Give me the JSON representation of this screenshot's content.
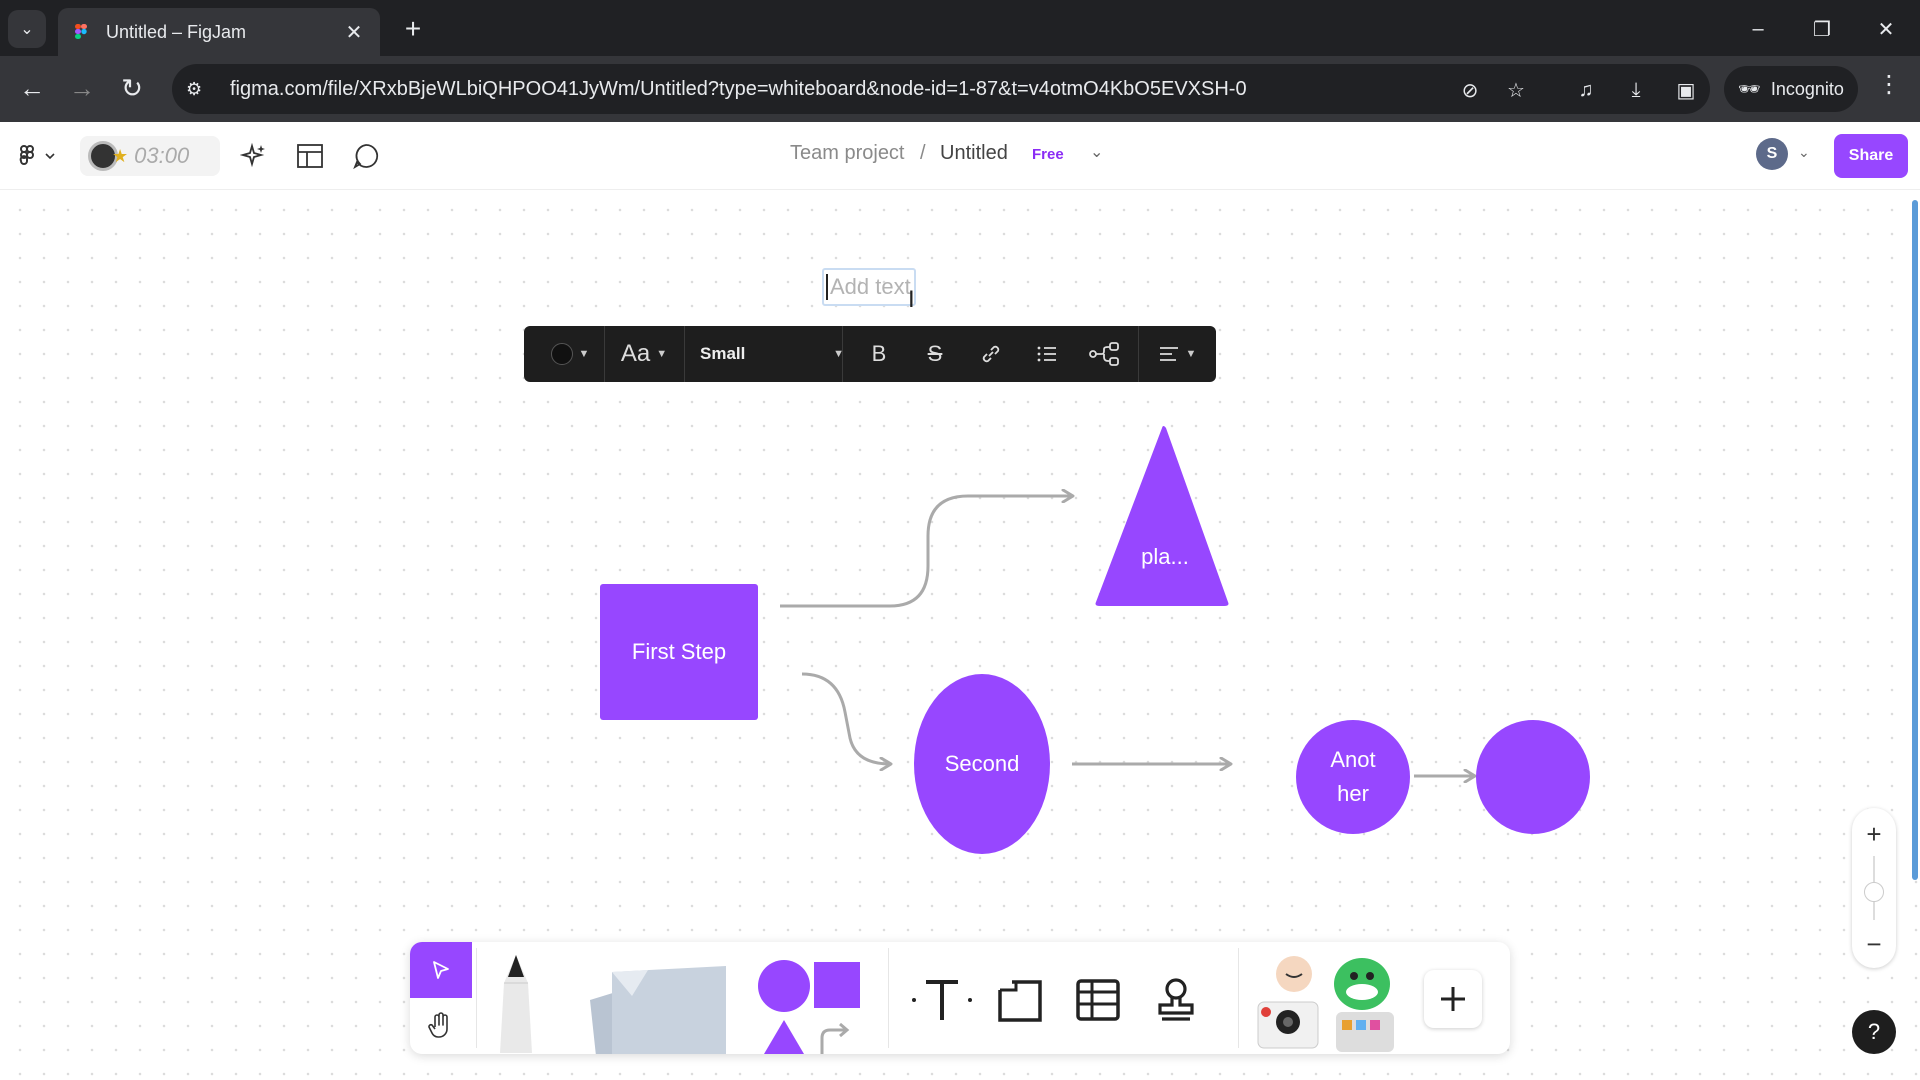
{
  "browser": {
    "tab_title": "Untitled – FigJam",
    "url": "figma.com/file/XRxbBjeWLbiQHPOO41JyWm/Untitled?type=whiteboard&node-id=1-87&t=v4otmO4KbO5EVXSH-0",
    "incognito_label": "Incognito"
  },
  "header": {
    "timer": "03:00",
    "project": "Team project",
    "separator": "/",
    "file_title": "Untitled",
    "plan_badge": "Free",
    "user_initial": "S",
    "share_label": "Share"
  },
  "canvas": {
    "text_placeholder": "Add text",
    "text_toolbar": {
      "font_icon": "Aa",
      "size_value": "Small"
    },
    "shapes": {
      "first_step": "First Step",
      "triangle": "pla...",
      "second": "Second",
      "another": "Anot\nher",
      "last": ""
    }
  },
  "zoom": {
    "in": "+",
    "out": "−"
  },
  "help": "?",
  "colors": {
    "accent": "#9747ff",
    "toolbar_dark": "#1e1e1e",
    "chrome": "#202124"
  },
  "icons": [
    "figma-menu-icon",
    "ai-sparkle-icon",
    "layout-icon",
    "comment-icon",
    "bold-icon",
    "strikethrough-icon",
    "link-icon",
    "list-icon",
    "connector-icon",
    "align-icon",
    "select-icon",
    "hand-icon",
    "pencil-icon",
    "sticky-note-icon",
    "shapes-icon",
    "text-tool-icon",
    "section-icon",
    "table-icon",
    "stamp-icon",
    "stickers-icon",
    "add-icon"
  ]
}
